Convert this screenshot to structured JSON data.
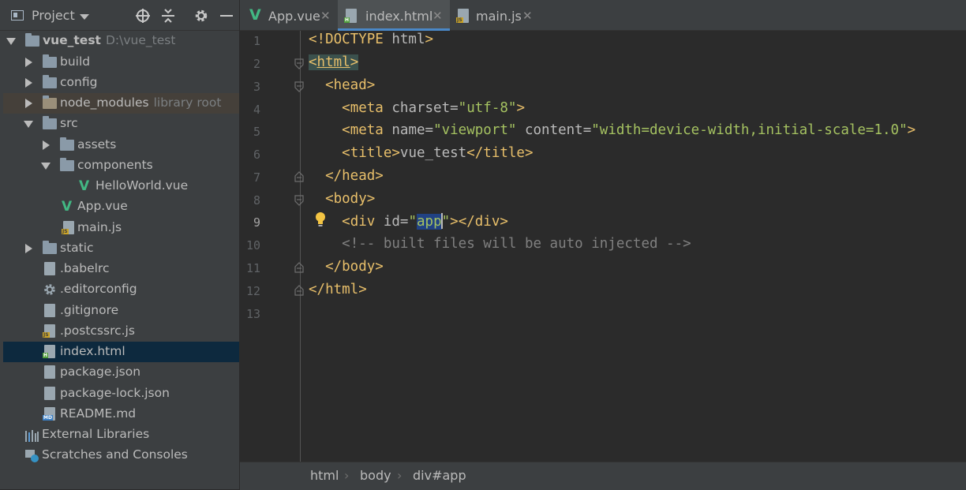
{
  "project_panel": {
    "title": "Project",
    "header_icons": [
      "crosshair-icon",
      "collapse-icon",
      "gear-icon",
      "minimize-icon"
    ],
    "tree": [
      {
        "label": "vue_test",
        "suffix": "D:\\vue_test",
        "type": "folder",
        "expanded": true
      },
      {
        "label": "build",
        "type": "folder"
      },
      {
        "label": "config",
        "type": "folder"
      },
      {
        "label": "node_modules",
        "suffix": "library root",
        "type": "folder"
      },
      {
        "label": "src",
        "type": "folder",
        "expanded": true
      },
      {
        "label": "assets",
        "type": "folder"
      },
      {
        "label": "components",
        "type": "folder",
        "expanded": true
      },
      {
        "label": "HelloWorld.vue",
        "type": "vue-file"
      },
      {
        "label": "App.vue",
        "type": "vue-file"
      },
      {
        "label": "main.js",
        "type": "js-file"
      },
      {
        "label": "static",
        "type": "folder"
      },
      {
        "label": ".babelrc",
        "type": "config-file"
      },
      {
        "label": ".editorconfig",
        "type": "settings-file"
      },
      {
        "label": ".gitignore",
        "type": "ignore-file"
      },
      {
        "label": ".postcssrc.js",
        "type": "js-file"
      },
      {
        "label": "index.html",
        "type": "html-file",
        "selected": true
      },
      {
        "label": "package.json",
        "type": "json-file"
      },
      {
        "label": "package-lock.json",
        "type": "json-file"
      },
      {
        "label": "README.md",
        "type": "md-file"
      },
      {
        "label": "External Libraries",
        "type": "libraries"
      },
      {
        "label": "Scratches and Consoles",
        "type": "scratches"
      }
    ],
    "file_badges": {
      "js": "JS",
      "html": "H",
      "md": "MD"
    }
  },
  "tabs": [
    {
      "label": "App.vue",
      "icon": "vue-icon"
    },
    {
      "label": "index.html",
      "icon": "html-file-icon",
      "active": true
    },
    {
      "label": "main.js",
      "icon": "js-file-icon"
    }
  ],
  "editor": {
    "line_numbers": [
      "1",
      "2",
      "3",
      "4",
      "5",
      "6",
      "7",
      "8",
      "9",
      "10",
      "11",
      "12",
      "13"
    ],
    "lines": {
      "l1_tag": "<!DOCTYPE",
      "l1_name": " html",
      "l1_close": ">",
      "l2_open": "<",
      "l2_name": "html",
      "l2_close": ">",
      "l3": "<head>",
      "l4_tag": "<meta ",
      "l4_attr": "charset=",
      "l4_val": "\"utf-8\"",
      "l4_close": ">",
      "l5_tag": "<meta ",
      "l5_attr1": "name=",
      "l5_val1": "\"viewport\"",
      "l5_attr2": " content=",
      "l5_val2": "\"width=device-width,initial-scale=1.0\"",
      "l5_close": ">",
      "l6_open": "<title>",
      "l6_text": "vue_test",
      "l6_close": "</title>",
      "l7": "</head>",
      "l8": "<body>",
      "l9_tag": "<div ",
      "l9_attr": "id=",
      "l9_q1": "\"",
      "l9_val": "app",
      "l9_q2": "\"",
      "l9_close": "></div>",
      "l10": "<!-- built files will be auto injected -->",
      "l11": "</body>",
      "l12": "</html>"
    }
  },
  "breadcrumbs": [
    "html",
    "body",
    "div#app"
  ],
  "colors": {
    "tag": "#e8bf6a",
    "attr_value": "#a5c261",
    "comment": "#808080",
    "selection": "#214283",
    "tab_underline": "#4a88c7",
    "vue_green": "#42b883"
  }
}
